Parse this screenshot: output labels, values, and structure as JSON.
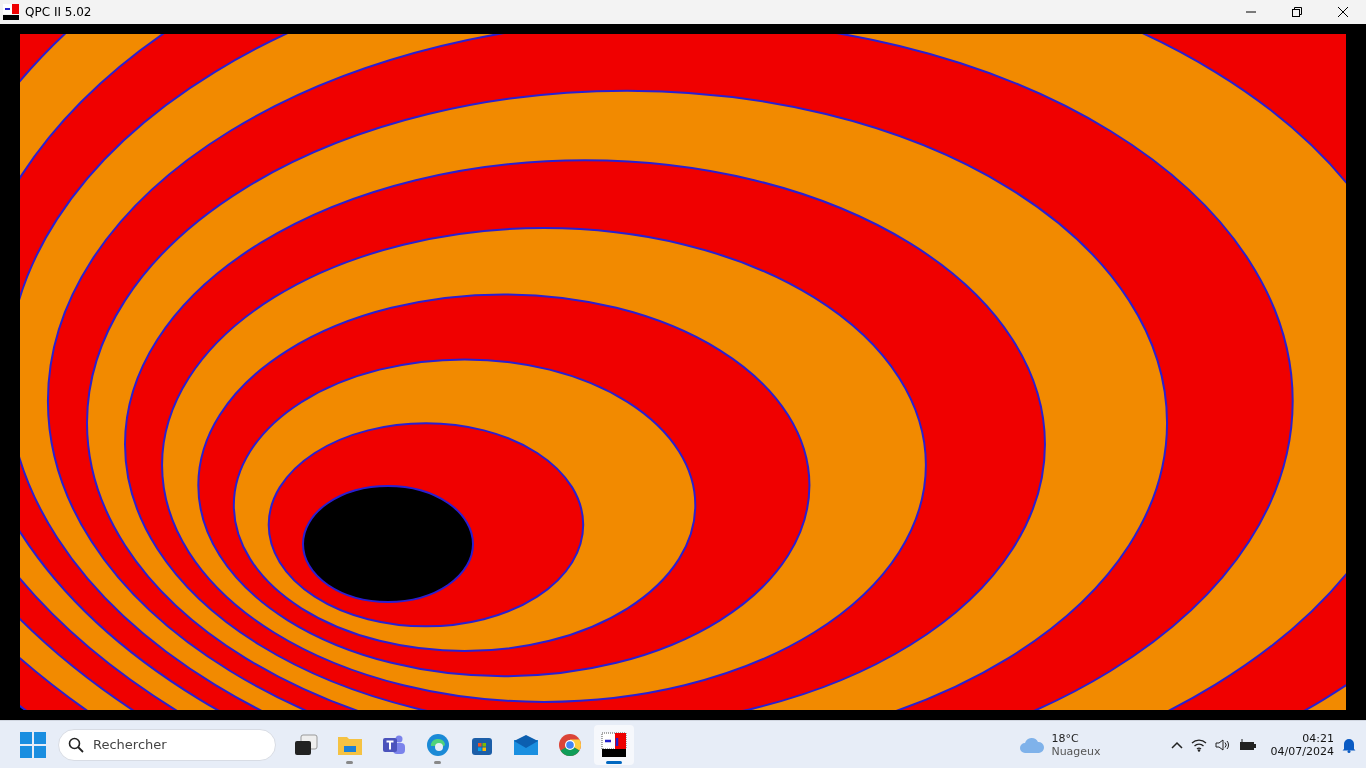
{
  "window": {
    "title": "QPC II 5.02"
  },
  "taskbar": {
    "search": {
      "placeholder": "Rechercher"
    },
    "apps": [
      {
        "kind": "task-view",
        "running": false,
        "selected": false
      },
      {
        "kind": "folder",
        "running": true,
        "selected": false
      },
      {
        "kind": "teams",
        "running": false,
        "selected": false
      },
      {
        "kind": "edge",
        "running": true,
        "selected": false
      },
      {
        "kind": "store",
        "running": false,
        "selected": false
      },
      {
        "kind": "mail",
        "running": false,
        "selected": false
      },
      {
        "kind": "chrome",
        "running": false,
        "selected": false
      },
      {
        "kind": "qpc",
        "running": true,
        "selected": true
      }
    ],
    "weather": {
      "temperature": "18°C",
      "condition": "Nuageux"
    },
    "clock": {
      "time": "04:21",
      "date": "04/07/2024"
    }
  }
}
